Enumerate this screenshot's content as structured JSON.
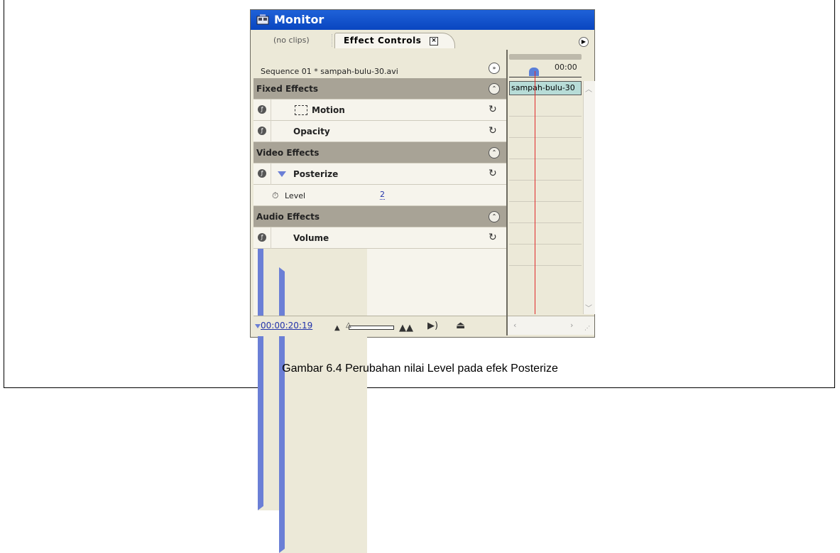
{
  "window": {
    "title": "Monitor"
  },
  "tabs": [
    {
      "label": "(no clips)"
    },
    {
      "label": "Effect Controls",
      "close": "×"
    }
  ],
  "sequence_label": "Sequence 01 * sampah-bulu-30.avi",
  "sections": {
    "fixed": "Fixed Effects",
    "video": "Video Effects",
    "audio": "Audio Effects"
  },
  "effects": {
    "motion": "Motion",
    "opacity": "Opacity",
    "posterize": "Posterize",
    "volume": "Volume"
  },
  "parameter": {
    "label": "Level",
    "value": "2"
  },
  "timeline": {
    "ruler_time": "00:00",
    "clip_name": "sampah-bulu-30"
  },
  "footer": {
    "timecode": "00:00:20:19"
  },
  "caption": "Gambar 6.4 Perubahan nilai Level pada efek Posterize",
  "icons": [
    "fx-toggle-icon",
    "expand-triangle-icon",
    "reset-icon",
    "collapse-icon",
    "stopwatch-icon",
    "play-audio-icon",
    "export-icon",
    "zoom-in-icon",
    "zoom-out-icon"
  ]
}
